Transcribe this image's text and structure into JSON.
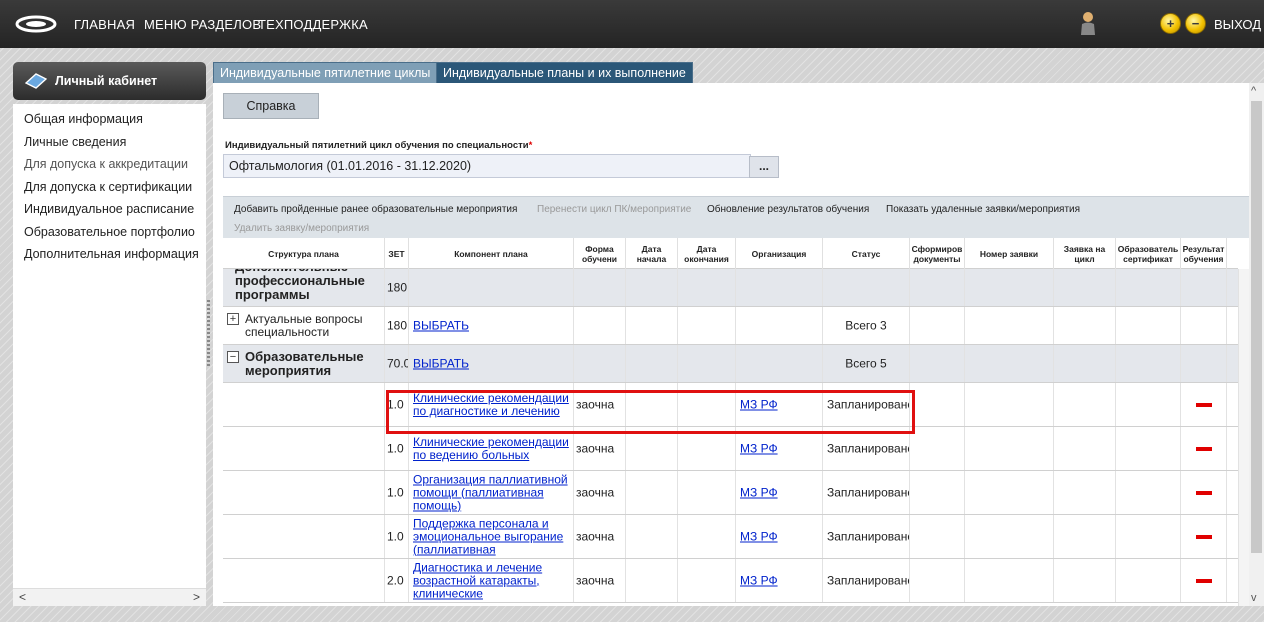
{
  "topbar": {
    "nav": [
      "ГЛАВНАЯ",
      "МЕНЮ РАЗДЕЛОВ",
      "ТЕХПОДДЕРЖКА"
    ],
    "zoom_in": "+",
    "zoom_out": "−",
    "exit": "ВЫХОД"
  },
  "sidebar": {
    "title": "Личный кабинет",
    "items": [
      "Общая информация",
      "Личные сведения",
      "Для допуска к аккредитации",
      "Для допуска к сертификации",
      "Индивидуальное расписание",
      "Образовательное портфолио",
      "Дополнительная информация"
    ],
    "scroll_left": "<",
    "scroll_right": ">"
  },
  "tabs": [
    "Индивидуальные пятилетние циклы",
    "Индивидуальные планы и их выполнение"
  ],
  "help_button": "Справка",
  "field": {
    "label": "Индивидуальный пятилетний цикл обучения по специальности",
    "required_mark": "*",
    "value": "Офтальмология (01.01.2016 - 31.12.2020)",
    "button": "..."
  },
  "toolbar": {
    "actions": [
      {
        "label": "Добавить пройденные ранее образовательные мероприятия",
        "enabled": true
      },
      {
        "label": "Перенести цикл ПК/мероприятие",
        "enabled": false
      },
      {
        "label": "Обновление результатов обучения",
        "enabled": true
      },
      {
        "label": "Показать удаленные заявки/мероприятия",
        "enabled": true
      },
      {
        "label": "Удалить заявку/мероприятия",
        "enabled": false
      }
    ]
  },
  "table": {
    "columns": [
      "Структура плана",
      "ЗЕТ",
      "Компонент плана",
      "Форма обучени",
      "Дата начала",
      "Дата окончания",
      "Организация",
      "Статус",
      "Сформиров документы",
      "Номер заявки",
      "Заявка на цикл",
      "Образователь сертификат",
      "Результат обучения"
    ],
    "rows": [
      {
        "type": "group",
        "structure": "Дополнительные профессиональные программы повышения",
        "zet": "180.0",
        "component": "",
        "form": "",
        "org": "",
        "status": "",
        "remove": false
      },
      {
        "type": "sub",
        "expander": "+",
        "structure": "Актуальные вопросы специальности",
        "zet": "180.0",
        "component": "ВЫБРАТЬ",
        "form": "",
        "org": "",
        "status": "Всего 3",
        "remove": false
      },
      {
        "type": "group",
        "expander": "−",
        "structure": "Образовательные мероприятия",
        "zet": "70.0",
        "component": "ВЫБРАТЬ",
        "form": "",
        "org": "",
        "status": "Всего 5",
        "remove": false
      },
      {
        "type": "item",
        "structure": "",
        "zet": "1.0",
        "component": "Клинические рекомендации по диагностике и лечению",
        "form": "заочна",
        "org": "МЗ РФ",
        "status": "Запланированс",
        "remove": true
      },
      {
        "type": "item",
        "structure": "",
        "zet": "1.0",
        "component": "Клинические рекомендации по ведению больных",
        "form": "заочна",
        "org": "МЗ РФ",
        "status": "Запланированс",
        "remove": true
      },
      {
        "type": "item",
        "structure": "",
        "zet": "1.0",
        "component": "Организация паллиативной помощи (паллиативная помощь)",
        "form": "заочна",
        "org": "МЗ РФ",
        "status": "Запланированс",
        "remove": true
      },
      {
        "type": "item",
        "structure": "",
        "zet": "1.0",
        "component": "Поддержка персонала и эмоциональное выгорание (паллиативная",
        "form": "заочна",
        "org": "МЗ РФ",
        "status": "Запланированс",
        "remove": true
      },
      {
        "type": "item",
        "structure": "",
        "zet": "2.0",
        "component": "Диагностика и лечение возрастной катаракты, клинические",
        "form": "заочна",
        "org": "МЗ РФ",
        "status": "Запланированс",
        "remove": true
      }
    ]
  },
  "colors": {
    "accent": "#2b5778",
    "tab_inactive": "#7f9fb6",
    "link": "#0022cc",
    "remove": "#e00000",
    "highlight": "#e01010"
  }
}
